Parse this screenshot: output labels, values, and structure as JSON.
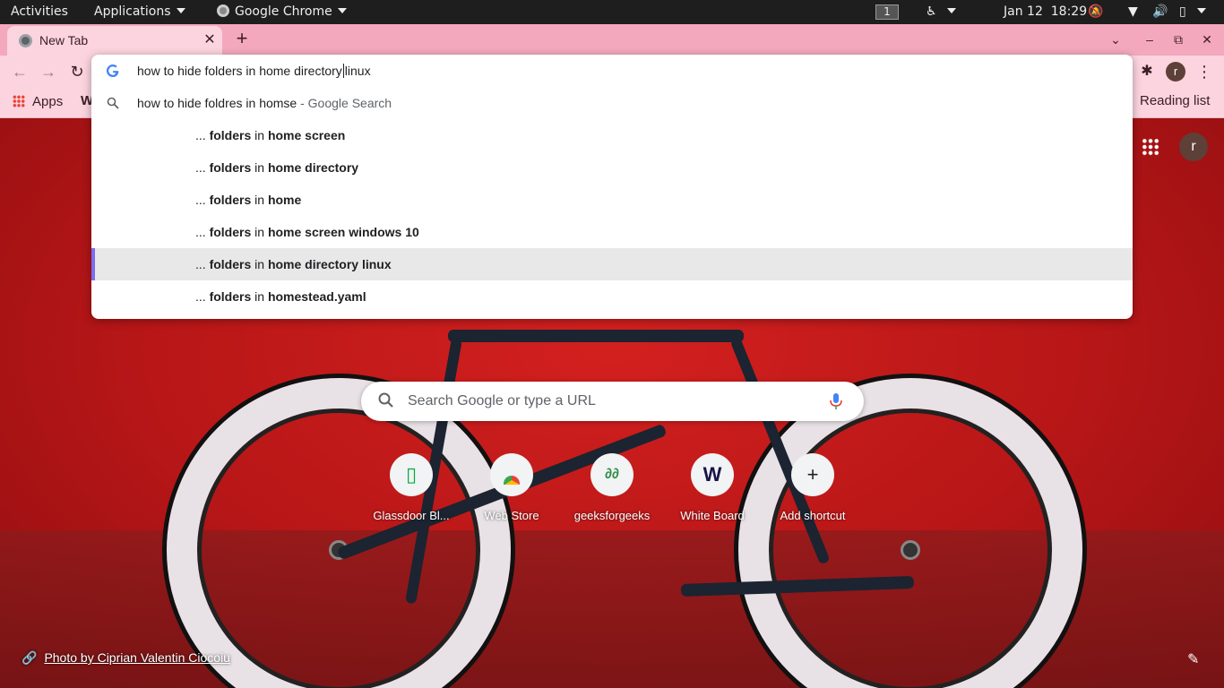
{
  "topbar": {
    "activities": "Activities",
    "applications": "Applications",
    "app_name": "Google Chrome",
    "workspace": "1",
    "date": "Jan 12",
    "time": "18:29"
  },
  "tab": {
    "title": "New Tab",
    "close": "✕"
  },
  "window_controls": {
    "newtab": "+",
    "dropdown": "⌄",
    "minimize": "–",
    "maximize": "⧉",
    "close": "✕"
  },
  "toolbar": {
    "back": "←",
    "forward": "→",
    "reload": "↻",
    "profile_initial": "r",
    "menu": "⋮",
    "extension_icon": "puzzle-icon"
  },
  "omnibox": {
    "query_before_cursor": "how to hide folders in home directory",
    "query_after_cursor": "linux",
    "first_suggestion": "how to hide foldres in homse",
    "first_suggestion_suffix": " - Google Search",
    "suggestions": [
      {
        "prefix": "... ",
        "b1": "folders",
        "mid": " in ",
        "b2": "home screen"
      },
      {
        "prefix": "... ",
        "b1": "folders",
        "mid": " in ",
        "b2": "home directory"
      },
      {
        "prefix": "... ",
        "b1": "folders",
        "mid": " in ",
        "b2": "home"
      },
      {
        "prefix": "... ",
        "b1": "folders",
        "mid": " in ",
        "b2": "home screen windows 10"
      },
      {
        "prefix": "... ",
        "b1": "folders",
        "mid": " in ",
        "b2": "home directory linux"
      },
      {
        "prefix": "... ",
        "b1": "folders",
        "mid": " in ",
        "b2": "homestead.yaml"
      }
    ],
    "selected_index": 4,
    "accent": "#7b6cf0"
  },
  "bookmarks": {
    "apps": "Apps",
    "w": "W",
    "reading_list": "Reading list"
  },
  "ntp": {
    "search_placeholder": "Search Google or type a URL",
    "profile_initial": "r",
    "shortcuts": [
      {
        "label": "Glassdoor Bl...",
        "icon": "glassdoor-icon"
      },
      {
        "label": "Web Store",
        "icon": "chrome-webstore-icon"
      },
      {
        "label": "geeksforgeeks",
        "icon": "geeksforgeeks-icon"
      },
      {
        "label": "White Board",
        "icon": "w-icon"
      },
      {
        "label": "Add shortcut",
        "icon": "plus-icon"
      }
    ],
    "credit": "Photo by Ciprian Valentin Ciocoiu"
  },
  "colors": {
    "tabstrip": "#f4a8bd",
    "toolbar": "#fbd4df",
    "background": "#b3151a"
  }
}
